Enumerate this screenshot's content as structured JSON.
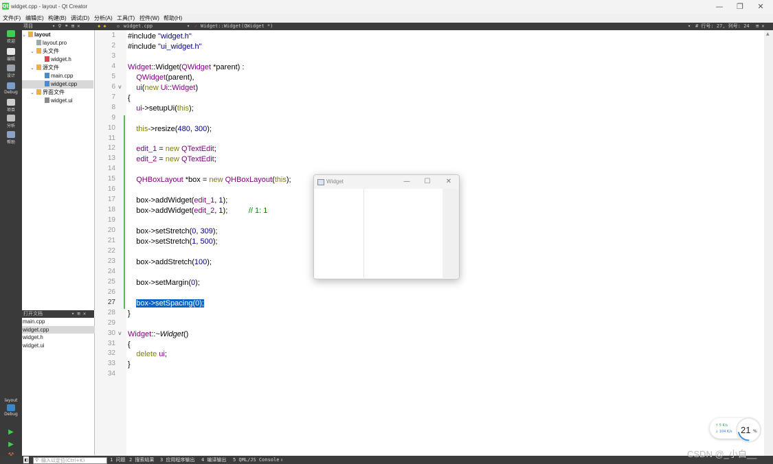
{
  "window": {
    "title": "widget.cpp - layout - Qt Creator",
    "app_icon": "Qt",
    "minimize": "—",
    "restore": "❐",
    "close": "✕"
  },
  "menubar": [
    "文件(F)",
    "编辑(E)",
    "构建(B)",
    "调试(D)",
    "分析(A)",
    "工具(T)",
    "控件(W)",
    "帮助(H)"
  ],
  "toolstrip": {
    "project_label": "项目",
    "file_combo": "widget.cpp",
    "symbol_combo": "Widget::Widget(QWidget *)",
    "position": "# 行号: 27, 列号: 24"
  },
  "modes": [
    {
      "label": "欢迎",
      "icon": "qt-logo-icon",
      "color": "#41cd52"
    },
    {
      "label": "编辑",
      "icon": "document-icon",
      "color": "#e8e8e8"
    },
    {
      "label": "设计",
      "icon": "pen-icon",
      "color": "#9aa0a6"
    },
    {
      "label": "Debug",
      "icon": "bug-icon",
      "color": "#7a9cc6"
    },
    {
      "label": "项目",
      "icon": "wrench-icon",
      "color": "#cfcfcf"
    },
    {
      "label": "分析",
      "icon": "monitor-icon",
      "color": "#bfbfbf"
    },
    {
      "label": "帮助",
      "icon": "help-icon",
      "color": "#8aa2c8"
    }
  ],
  "kit": {
    "project": "layout",
    "mode": "Debug"
  },
  "tree": [
    {
      "label": "layout",
      "depth": 0,
      "twisty": "v",
      "icon": "folder",
      "bold": true
    },
    {
      "label": "layout.pro",
      "depth": 1,
      "twisty": "",
      "icon": "pro"
    },
    {
      "label": "头文件",
      "depth": 1,
      "twisty": "v",
      "icon": "folder"
    },
    {
      "label": "widget.h",
      "depth": 2,
      "twisty": "",
      "icon": "h"
    },
    {
      "label": "源文件",
      "depth": 1,
      "twisty": "v",
      "icon": "folder"
    },
    {
      "label": "main.cpp",
      "depth": 2,
      "twisty": "",
      "icon": "cpp"
    },
    {
      "label": "widget.cpp",
      "depth": 2,
      "twisty": "",
      "icon": "cpp",
      "selected": true
    },
    {
      "label": "界面文件",
      "depth": 1,
      "twisty": "v",
      "icon": "folder"
    },
    {
      "label": "widget.ui",
      "depth": 2,
      "twisty": "",
      "icon": "ui"
    }
  ],
  "open_docs": {
    "title": "打开文档",
    "items": [
      "main.cpp",
      "widget.cpp",
      "widget.h",
      "widget.ui"
    ],
    "selected": 1
  },
  "code": [
    {
      "n": "1",
      "t": [
        [
          "#include ",
          ""
        ],
        [
          "\"widget.h\"",
          "nm"
        ]
      ]
    },
    {
      "n": "2",
      "t": [
        [
          "#include ",
          ""
        ],
        [
          "\"ui_widget.h\"",
          "nm"
        ]
      ]
    },
    {
      "n": "3",
      "t": []
    },
    {
      "n": "4",
      "t": [
        [
          "Widget",
          "ty"
        ],
        [
          "::",
          ""
        ],
        [
          "Widget",
          ""
        ],
        [
          "(",
          ""
        ],
        [
          "QWidget",
          "ty"
        ],
        [
          " *parent) :",
          ""
        ]
      ]
    },
    {
      "n": "5",
      "t": [
        [
          "    ",
          ""
        ],
        [
          "QWidget",
          "ty"
        ],
        [
          "(parent),",
          ""
        ]
      ]
    },
    {
      "n": "6",
      "t": [
        [
          "    ",
          ""
        ],
        [
          "ui",
          "ty"
        ],
        [
          "(",
          ""
        ],
        [
          "new ",
          "kw"
        ],
        [
          "Ui",
          "ty"
        ],
        [
          "::",
          ""
        ],
        [
          "Widget",
          "ty"
        ],
        [
          ")",
          ""
        ]
      ],
      "fold": "v"
    },
    {
      "n": "7",
      "t": [
        [
          "{",
          ""
        ]
      ]
    },
    {
      "n": "8",
      "t": [
        [
          "    ",
          ""
        ],
        [
          "ui",
          "ty"
        ],
        [
          "->setupUi(",
          ""
        ],
        [
          "this",
          "kw"
        ],
        [
          ");",
          ""
        ]
      ]
    },
    {
      "n": "9",
      "t": []
    },
    {
      "n": "10",
      "t": [
        [
          "    ",
          ""
        ],
        [
          "this",
          "kw"
        ],
        [
          "->resize(",
          ""
        ],
        [
          "480",
          "nm"
        ],
        [
          ", ",
          ""
        ],
        [
          "300",
          "nm"
        ],
        [
          ");",
          ""
        ]
      ]
    },
    {
      "n": "11",
      "t": []
    },
    {
      "n": "12",
      "t": [
        [
          "    ",
          ""
        ],
        [
          "edit_1",
          "ty"
        ],
        [
          " = ",
          ""
        ],
        [
          "new ",
          "kw"
        ],
        [
          "QTextEdit",
          "ty"
        ],
        [
          ";",
          ""
        ]
      ]
    },
    {
      "n": "13",
      "t": [
        [
          "    ",
          ""
        ],
        [
          "edit_2",
          "ty"
        ],
        [
          " = ",
          ""
        ],
        [
          "new ",
          "kw"
        ],
        [
          "QTextEdit",
          "ty"
        ],
        [
          ";",
          ""
        ]
      ]
    },
    {
      "n": "14",
      "t": []
    },
    {
      "n": "15",
      "t": [
        [
          "    ",
          ""
        ],
        [
          "QHBoxLayout",
          "ty"
        ],
        [
          " *box = ",
          ""
        ],
        [
          "new ",
          "kw"
        ],
        [
          "QHBoxLayout",
          "ty"
        ],
        [
          "(",
          ""
        ],
        [
          "this",
          "kw"
        ],
        [
          ");",
          ""
        ]
      ]
    },
    {
      "n": "16",
      "t": []
    },
    {
      "n": "17",
      "t": [
        [
          "    box->addWidget(",
          ""
        ],
        [
          "edit_1",
          "ty"
        ],
        [
          ", ",
          ""
        ],
        [
          "1",
          "nm"
        ],
        [
          ");",
          ""
        ]
      ]
    },
    {
      "n": "18",
      "t": [
        [
          "    box->addWidget(",
          ""
        ],
        [
          "edit_2",
          "ty"
        ],
        [
          ", ",
          ""
        ],
        [
          "1",
          "nm"
        ],
        [
          ");          ",
          ""
        ],
        [
          "// 1: 1",
          "cm"
        ]
      ]
    },
    {
      "n": "19",
      "t": []
    },
    {
      "n": "20",
      "t": [
        [
          "    box->setStretch(",
          ""
        ],
        [
          "0",
          "nm"
        ],
        [
          ", ",
          ""
        ],
        [
          "309",
          "nm"
        ],
        [
          ");",
          ""
        ]
      ]
    },
    {
      "n": "21",
      "t": [
        [
          "    box->setStretch(",
          ""
        ],
        [
          "1",
          "nm"
        ],
        [
          ", ",
          ""
        ],
        [
          "500",
          "nm"
        ],
        [
          ");",
          ""
        ]
      ]
    },
    {
      "n": "22",
      "t": []
    },
    {
      "n": "23",
      "t": [
        [
          "    box->addStretch(",
          ""
        ],
        [
          "100",
          "nm"
        ],
        [
          ");",
          ""
        ]
      ]
    },
    {
      "n": "24",
      "t": []
    },
    {
      "n": "25",
      "t": [
        [
          "    box->setMargin(",
          ""
        ],
        [
          "0",
          "nm"
        ],
        [
          ");",
          ""
        ]
      ]
    },
    {
      "n": "26",
      "t": []
    },
    {
      "n": "27",
      "t": [
        [
          "    ",
          ""
        ],
        [
          "box->setSpacing(0);",
          "hl"
        ]
      ],
      "current": true
    },
    {
      "n": "28",
      "t": [
        [
          "}",
          ""
        ]
      ]
    },
    {
      "n": "29",
      "t": []
    },
    {
      "n": "30",
      "t": [
        [
          "Widget",
          "ty"
        ],
        [
          "::~",
          ""
        ],
        [
          "Widget",
          "it"
        ],
        [
          "()",
          ""
        ]
      ],
      "fold": "v"
    },
    {
      "n": "31",
      "t": [
        [
          "{",
          ""
        ]
      ]
    },
    {
      "n": "32",
      "t": [
        [
          "    ",
          ""
        ],
        [
          "delete ",
          "kw"
        ],
        [
          "ui",
          "ty"
        ],
        [
          ";",
          ""
        ]
      ]
    },
    {
      "n": "33",
      "t": [
        [
          "}",
          ""
        ]
      ]
    },
    {
      "n": "34",
      "t": []
    }
  ],
  "widget_window": {
    "title": "Widget",
    "minimize": "—",
    "maximize": "☐",
    "close": "✕"
  },
  "statusbar": {
    "locator_placeholder": "输入以定位(Ctrl+K)",
    "tabs": [
      "1 问题",
      "2 搜索结果",
      "3 应用程序输出",
      "4 编译输出",
      "5 QML/JS Console"
    ]
  },
  "net": {
    "up": "5  K/s",
    "down": "104 K/s",
    "percent": "21",
    "unit": "%"
  },
  "watermark": "CSDN @_小白__"
}
